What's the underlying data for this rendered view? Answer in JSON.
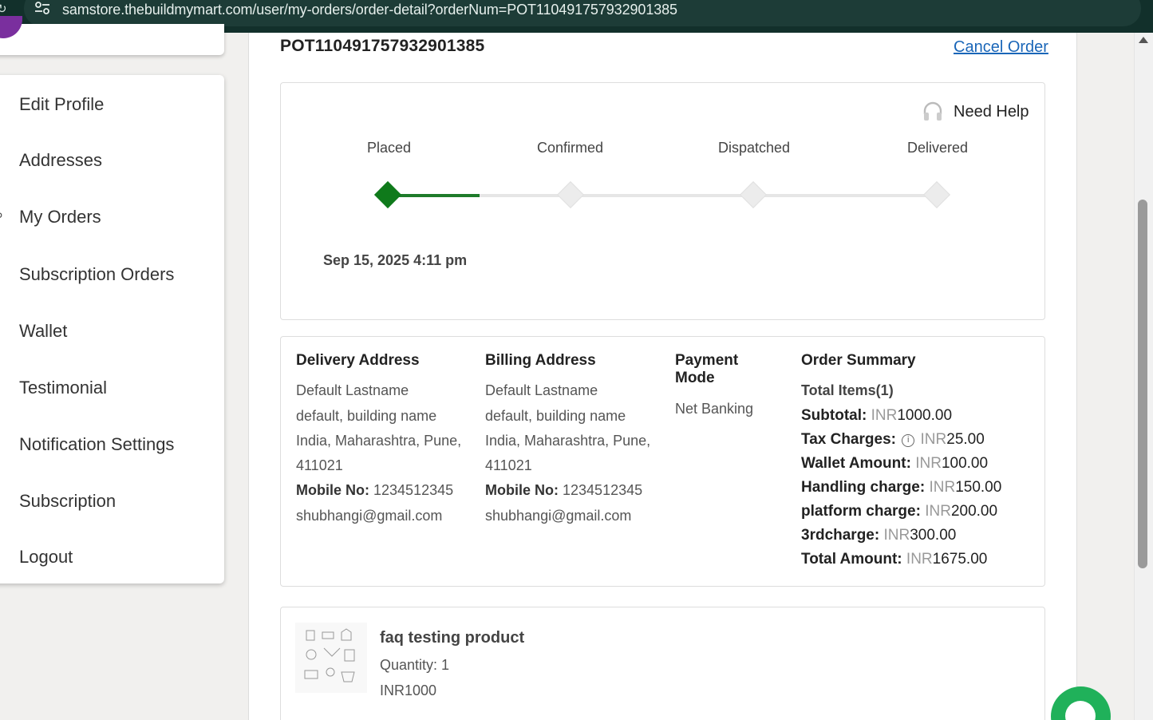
{
  "browser": {
    "url": "samstore.thebuildmymart.com/user/my-orders/order-detail?orderNum=POT110491757932901385"
  },
  "sidebar": {
    "items": [
      {
        "label": "Edit Profile"
      },
      {
        "label": "Addresses"
      },
      {
        "label": "My Orders"
      },
      {
        "label": "Subscription Orders"
      },
      {
        "label": "Wallet"
      },
      {
        "label": "Testimonial"
      },
      {
        "label": "Notification Settings"
      },
      {
        "label": "Subscription"
      },
      {
        "label": "Logout"
      }
    ]
  },
  "order": {
    "number": "POT110491757932901385",
    "cancel_label": "Cancel Order",
    "need_help": "Need Help",
    "steps": [
      {
        "label": "Placed",
        "done": true
      },
      {
        "label": "Confirmed",
        "done": false
      },
      {
        "label": "Dispatched",
        "done": false
      },
      {
        "label": "Delivered",
        "done": false
      }
    ],
    "placed_date": "Sep 15, 2025 4:11 pm"
  },
  "delivery": {
    "title": "Delivery Address",
    "name": "Default Lastname",
    "line1": "default, building name",
    "line2": "India, Maharashtra, Pune,",
    "pin": "411021",
    "mobile_label": "Mobile No:",
    "mobile": "1234512345",
    "email": "shubhangi@gmail.com"
  },
  "billing": {
    "title": "Billing Address",
    "name": "Default Lastname",
    "line1": "default, building name",
    "line2": "India, Maharashtra, Pune,",
    "pin": "411021",
    "mobile_label": "Mobile No:",
    "mobile": "1234512345",
    "email": "shubhangi@gmail.com"
  },
  "payment": {
    "title_line1": "Payment",
    "title_line2": "Mode",
    "value": "Net Banking"
  },
  "summary": {
    "title": "Order Summary",
    "total_items": "Total Items(1)",
    "currency": "INR",
    "rows": [
      {
        "label": "Subtotal:",
        "value": "1000.00"
      },
      {
        "label": "Tax Charges:",
        "value": "25.00"
      },
      {
        "label": "Wallet Amount:",
        "value": "100.00"
      },
      {
        "label": "Handling charge:",
        "value": "150.00"
      },
      {
        "label": "platform charge:",
        "value": "200.00"
      },
      {
        "label": "3rdcharge:",
        "value": "300.00"
      },
      {
        "label": "Total Amount:",
        "value": "1675.00"
      }
    ]
  },
  "product": {
    "name": "faq testing product",
    "quantity": "Quantity: 1",
    "price": "INR1000"
  },
  "colors": {
    "accent_green": "#0f7a1b",
    "link_blue": "#1a66b8",
    "chat_green": "#20b15a"
  }
}
